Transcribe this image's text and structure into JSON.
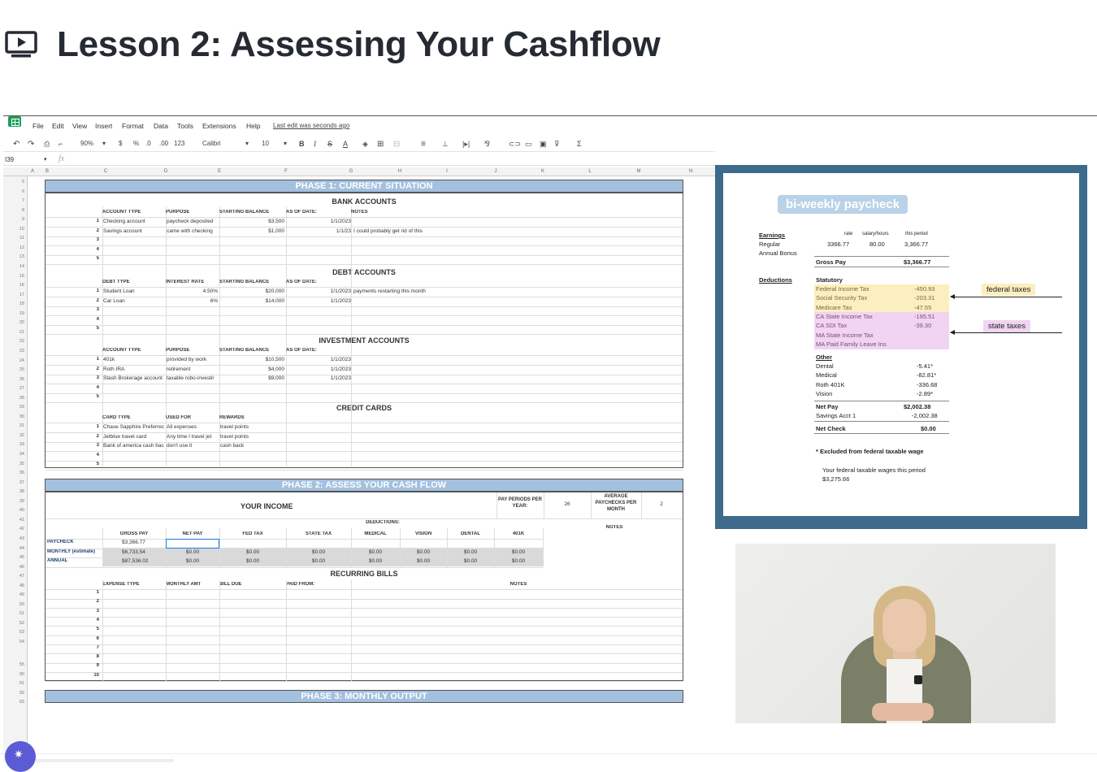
{
  "page": {
    "title": "Lesson 2: Assessing Your Cashflow",
    "icon": "play-video-icon"
  },
  "sheet": {
    "menu": [
      "File",
      "Edit",
      "View",
      "Insert",
      "Format",
      "Data",
      "Tools",
      "Extensions",
      "Help"
    ],
    "last_edit": "Last edit was seconds ago",
    "toolbar": {
      "zoom": "90%",
      "currency": "$",
      "percent": "%",
      "dec_less": ".0",
      "dec_more": ".00",
      "format": "123",
      "font": "Calibri",
      "size": "10",
      "bold": "B",
      "italic": "I",
      "strike": "S",
      "text_color": "A"
    },
    "cell_ref": "I39",
    "fx": "fx",
    "columns": [
      "A",
      "B",
      "C",
      "D",
      "E",
      "F",
      "G",
      "H",
      "I",
      "J",
      "K",
      "L",
      "M",
      "N"
    ],
    "rows": [
      "5",
      "6",
      "7",
      "8",
      "9",
      "10",
      "11",
      "12",
      "13",
      "14",
      "15",
      "16",
      "17",
      "18",
      "19",
      "20",
      "21",
      "22",
      "23",
      "24",
      "25",
      "26",
      "27",
      "28",
      "29",
      "30",
      "31",
      "32",
      "33",
      "34",
      "35",
      "36",
      "37",
      "38",
      "39",
      "40",
      "41",
      "42",
      "43",
      "44",
      "45",
      "46",
      "47",
      "48",
      "49",
      "50",
      "51",
      "52",
      "53",
      "54",
      "55",
      "90",
      "91",
      "92",
      "93"
    ],
    "phase1": {
      "title": "PHASE 1: CURRENT SITUATION",
      "bank": {
        "title": "BANK ACCOUNTS",
        "headers": [
          "ACCOUNT TYPE",
          "PURPOSE",
          "STARTING BALANCE",
          "AS OF DATE:",
          "NOTES"
        ],
        "rows": [
          [
            "1",
            "Checking account",
            "paycheck deposited",
            "$3,500",
            "1/1/2023",
            ""
          ],
          [
            "2",
            "Savings account",
            "came with checking",
            "$1,000",
            "1/1/23",
            "I could probably get rid of this"
          ],
          [
            "3",
            "",
            "",
            "",
            "",
            ""
          ],
          [
            "4",
            "",
            "",
            "",
            "",
            ""
          ],
          [
            "5",
            "",
            "",
            "",
            "",
            ""
          ]
        ]
      },
      "debt": {
        "title": "DEBT ACCOUNTS",
        "headers": [
          "DEBT TYPE",
          "INTEREST RATE",
          "STARTING BALANCE",
          "AS OF DATE:"
        ],
        "rows": [
          [
            "1",
            "Student Loan",
            "4.50%",
            "$20,000",
            "1/1/2023",
            "payments restarting this month"
          ],
          [
            "2",
            "Car Loan",
            "6%",
            "$14,000",
            "1/1/2023",
            ""
          ],
          [
            "3",
            "",
            "",
            "",
            "",
            ""
          ],
          [
            "4",
            "",
            "",
            "",
            "",
            ""
          ],
          [
            "5",
            "",
            "",
            "",
            "",
            ""
          ]
        ]
      },
      "invest": {
        "title": "INVESTMENT ACCOUNTS",
        "headers": [
          "ACCOUNT TYPE",
          "PURPOSE",
          "STARTING BALANCE",
          "AS OF DATE:"
        ],
        "rows": [
          [
            "1",
            "401k",
            "provided by work",
            "$10,500",
            "1/1/2023"
          ],
          [
            "2",
            "Roth IRA",
            "retirement",
            "$4,000",
            "1/1/2023"
          ],
          [
            "3",
            "Stash Brokerage account",
            "taxable robo-investir",
            "$9,000",
            "1/1/2023"
          ],
          [
            "4",
            "",
            "",
            "",
            ""
          ],
          [
            "5",
            "",
            "",
            "",
            ""
          ]
        ]
      },
      "credit": {
        "title": "CREDIT CARDS",
        "headers": [
          "CARD TYPE",
          "USED FOR",
          "REWARDS"
        ],
        "rows": [
          [
            "1",
            "Chase Sapphire Preferrec",
            "All expenses",
            "travel points"
          ],
          [
            "2",
            "Jetblue travel card",
            "Any time I travel jet",
            "travel points"
          ],
          [
            "3",
            "Bank of america cash bac",
            "don't use it",
            "cash back"
          ],
          [
            "4",
            "",
            "",
            ""
          ],
          [
            "5",
            "",
            "",
            ""
          ]
        ]
      }
    },
    "phase2": {
      "title": "PHASE 2: ASSESS YOUR CASH FLOW",
      "income_title": "YOUR INCOME",
      "pay_periods_label": "PAY PERIODS PER YEAR:",
      "pay_periods": "26",
      "avg_label": "AVERAGE PAYCHECKS PER MONTH",
      "avg": "2",
      "deductions_label": "DEDUCTIONS:",
      "notes_label": "NOTES",
      "headers": [
        "GROSS PAY",
        "NET PAY",
        "FED TAX",
        "STATE TAX",
        "MEDICAL",
        "VISION",
        "DENTAL",
        "401K"
      ],
      "rows": [
        {
          "label": "PAYCHECK",
          "values": [
            "$3,366.77",
            "",
            "",
            "",
            "",
            "",
            "",
            ""
          ]
        },
        {
          "label": "MONTHLY (estimate)",
          "values": [
            "$6,733.54",
            "$0.00",
            "$0.00",
            "$0.00",
            "$0.00",
            "$0.00",
            "$0.00",
            "$0.00"
          ]
        },
        {
          "label": "ANNUAL",
          "values": [
            "$87,536.02",
            "$0.00",
            "$0.00",
            "$0.00",
            "$0.00",
            "$0.00",
            "$0.00",
            "$0.00"
          ]
        }
      ],
      "bills_title": "RECURRING BILLS",
      "bills_headers": [
        "EXPENSE TYPE",
        "MONTHLY AMT",
        "BILL DUE",
        "PAID FROM:",
        "NOTES"
      ],
      "bill_numbers": [
        "1",
        "2",
        "3",
        "4",
        "5",
        "6",
        "7",
        "8",
        "9",
        "10"
      ]
    },
    "phase3": {
      "title": "PHASE 3: MONTHLY OUTPUT"
    }
  },
  "slide": {
    "pill": "bi-weekly paycheck",
    "earnings_label": "Earnings",
    "col_rate": "rate",
    "col_hours": "salary/hours",
    "col_period": "this period",
    "regular": {
      "label": "Regular",
      "rate": "3366.77",
      "hours": "80.00",
      "period": "3,366.77"
    },
    "bonus_label": "Annual Bonus",
    "gross": {
      "label": "Gross Pay",
      "value": "$3,366.77"
    },
    "deductions_label": "Deductions",
    "statutory_label": "Statutory",
    "statutory": [
      {
        "label": "Federal Income Tax",
        "value": "-450.93",
        "group": "fed"
      },
      {
        "label": "Social Security Tax",
        "value": "-203.31",
        "group": "fed"
      },
      {
        "label": "Medicare Tax",
        "value": "-47.55",
        "group": "fed"
      },
      {
        "label": "CA State Income Tax",
        "value": "-195.51",
        "group": "state"
      },
      {
        "label": "CA SDI Tax",
        "value": "-39.30",
        "group": "state"
      },
      {
        "label": "MA State Income Tax",
        "value": "",
        "group": "state"
      },
      {
        "label": "MA Paid Family Leave Ins",
        "value": "",
        "group": "state"
      }
    ],
    "other_label": "Other",
    "other": [
      {
        "label": "Dental",
        "value": "-5.41*"
      },
      {
        "label": "Medical",
        "value": "-82.81*"
      },
      {
        "label": "Roth 401K",
        "value": "-336.68"
      },
      {
        "label": "Vision",
        "value": "-2.89*"
      }
    ],
    "net_pay": {
      "label": "Net Pay",
      "value": "$2,002.38"
    },
    "savings": {
      "label": "Savings Acct 1",
      "value": "-2,002.38"
    },
    "net_check": {
      "label": "Net Check",
      "value": "$0.00"
    },
    "footnote": "* Excluded from federal taxable wage",
    "taxable_text": "Your federal taxable wages this period",
    "taxable_value": "$3,275.66",
    "callout_fed": "federal taxes",
    "callout_state": "state taxes",
    "colors": {
      "frame": "#3e6b8c",
      "fed_highlight": "#fbefbf",
      "state_highlight": "#f1d4f2",
      "pill": "#b9d2e8"
    }
  },
  "video": {
    "subject": "presenter-video"
  }
}
